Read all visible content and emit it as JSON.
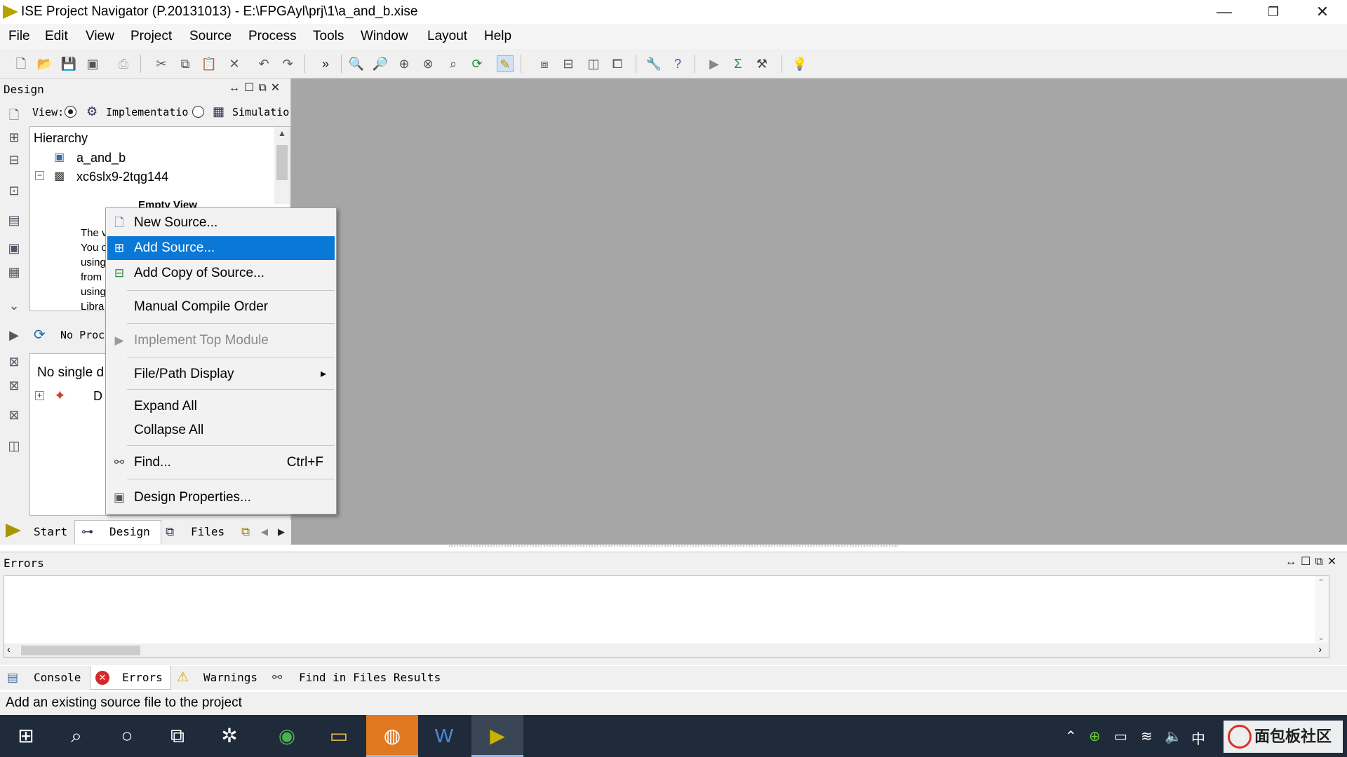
{
  "window": {
    "title": "ISE Project Navigator (P.20131013) - E:\\FPGAyl\\prj\\1\\a_and_b.xise",
    "minimize": "—",
    "restore": "❐",
    "close": "✕"
  },
  "menubar": {
    "items": [
      "File",
      "Edit",
      "View",
      "Project",
      "Source",
      "Process",
      "Tools",
      "Window",
      "Layout",
      "Help"
    ]
  },
  "toolbar": {
    "overflow": "»"
  },
  "design_panel": {
    "title": "Design",
    "view_label": "View:",
    "implementation_label": "Implementatio",
    "simulation_label": "Simulatio",
    "hierarchy_title": "Hierarchy",
    "tree": {
      "item1": "a_and_b",
      "item2": "xc6slx9-2tqg144",
      "empty_view": "Empty View",
      "partial_lines": [
        "The v",
        "You c",
        "using",
        "from",
        "using",
        "Libra"
      ]
    },
    "processes_label": "No Proc",
    "processes_text": "No single d",
    "proc_tree_partial": "D",
    "tabs": [
      "Start",
      "Design",
      "Files"
    ]
  },
  "context_menu": {
    "items": [
      {
        "label": "New Source...",
        "icon": "new-source-icon"
      },
      {
        "label": "Add Source...",
        "icon": "add-source-icon"
      },
      {
        "label": "Add Copy of Source...",
        "icon": "add-copy-icon"
      },
      {
        "label": "Manual Compile Order"
      },
      {
        "label": "Implement Top Module",
        "icon": "play-icon"
      },
      {
        "label": "File/Path Display",
        "submenu_arrow": "▸"
      },
      {
        "label": "Expand All"
      },
      {
        "label": "Collapse All"
      },
      {
        "label": "Find...",
        "shortcut": "Ctrl+F",
        "icon": "binoculars-icon"
      },
      {
        "label": "Design Properties...",
        "icon": "properties-icon"
      }
    ]
  },
  "errors_panel": {
    "title": "Errors",
    "tabs": [
      "Console",
      "Errors",
      "Warnings",
      "Find in Files Results"
    ]
  },
  "statusbar": {
    "text": "Add an existing source file to the project"
  },
  "taskbar": {
    "tray_ime": "中",
    "watermark": "面包板社区"
  },
  "colors": {
    "selection": "#0a78d7",
    "workspace": "#a6a6a6",
    "taskbar": "#1f2a3a"
  }
}
